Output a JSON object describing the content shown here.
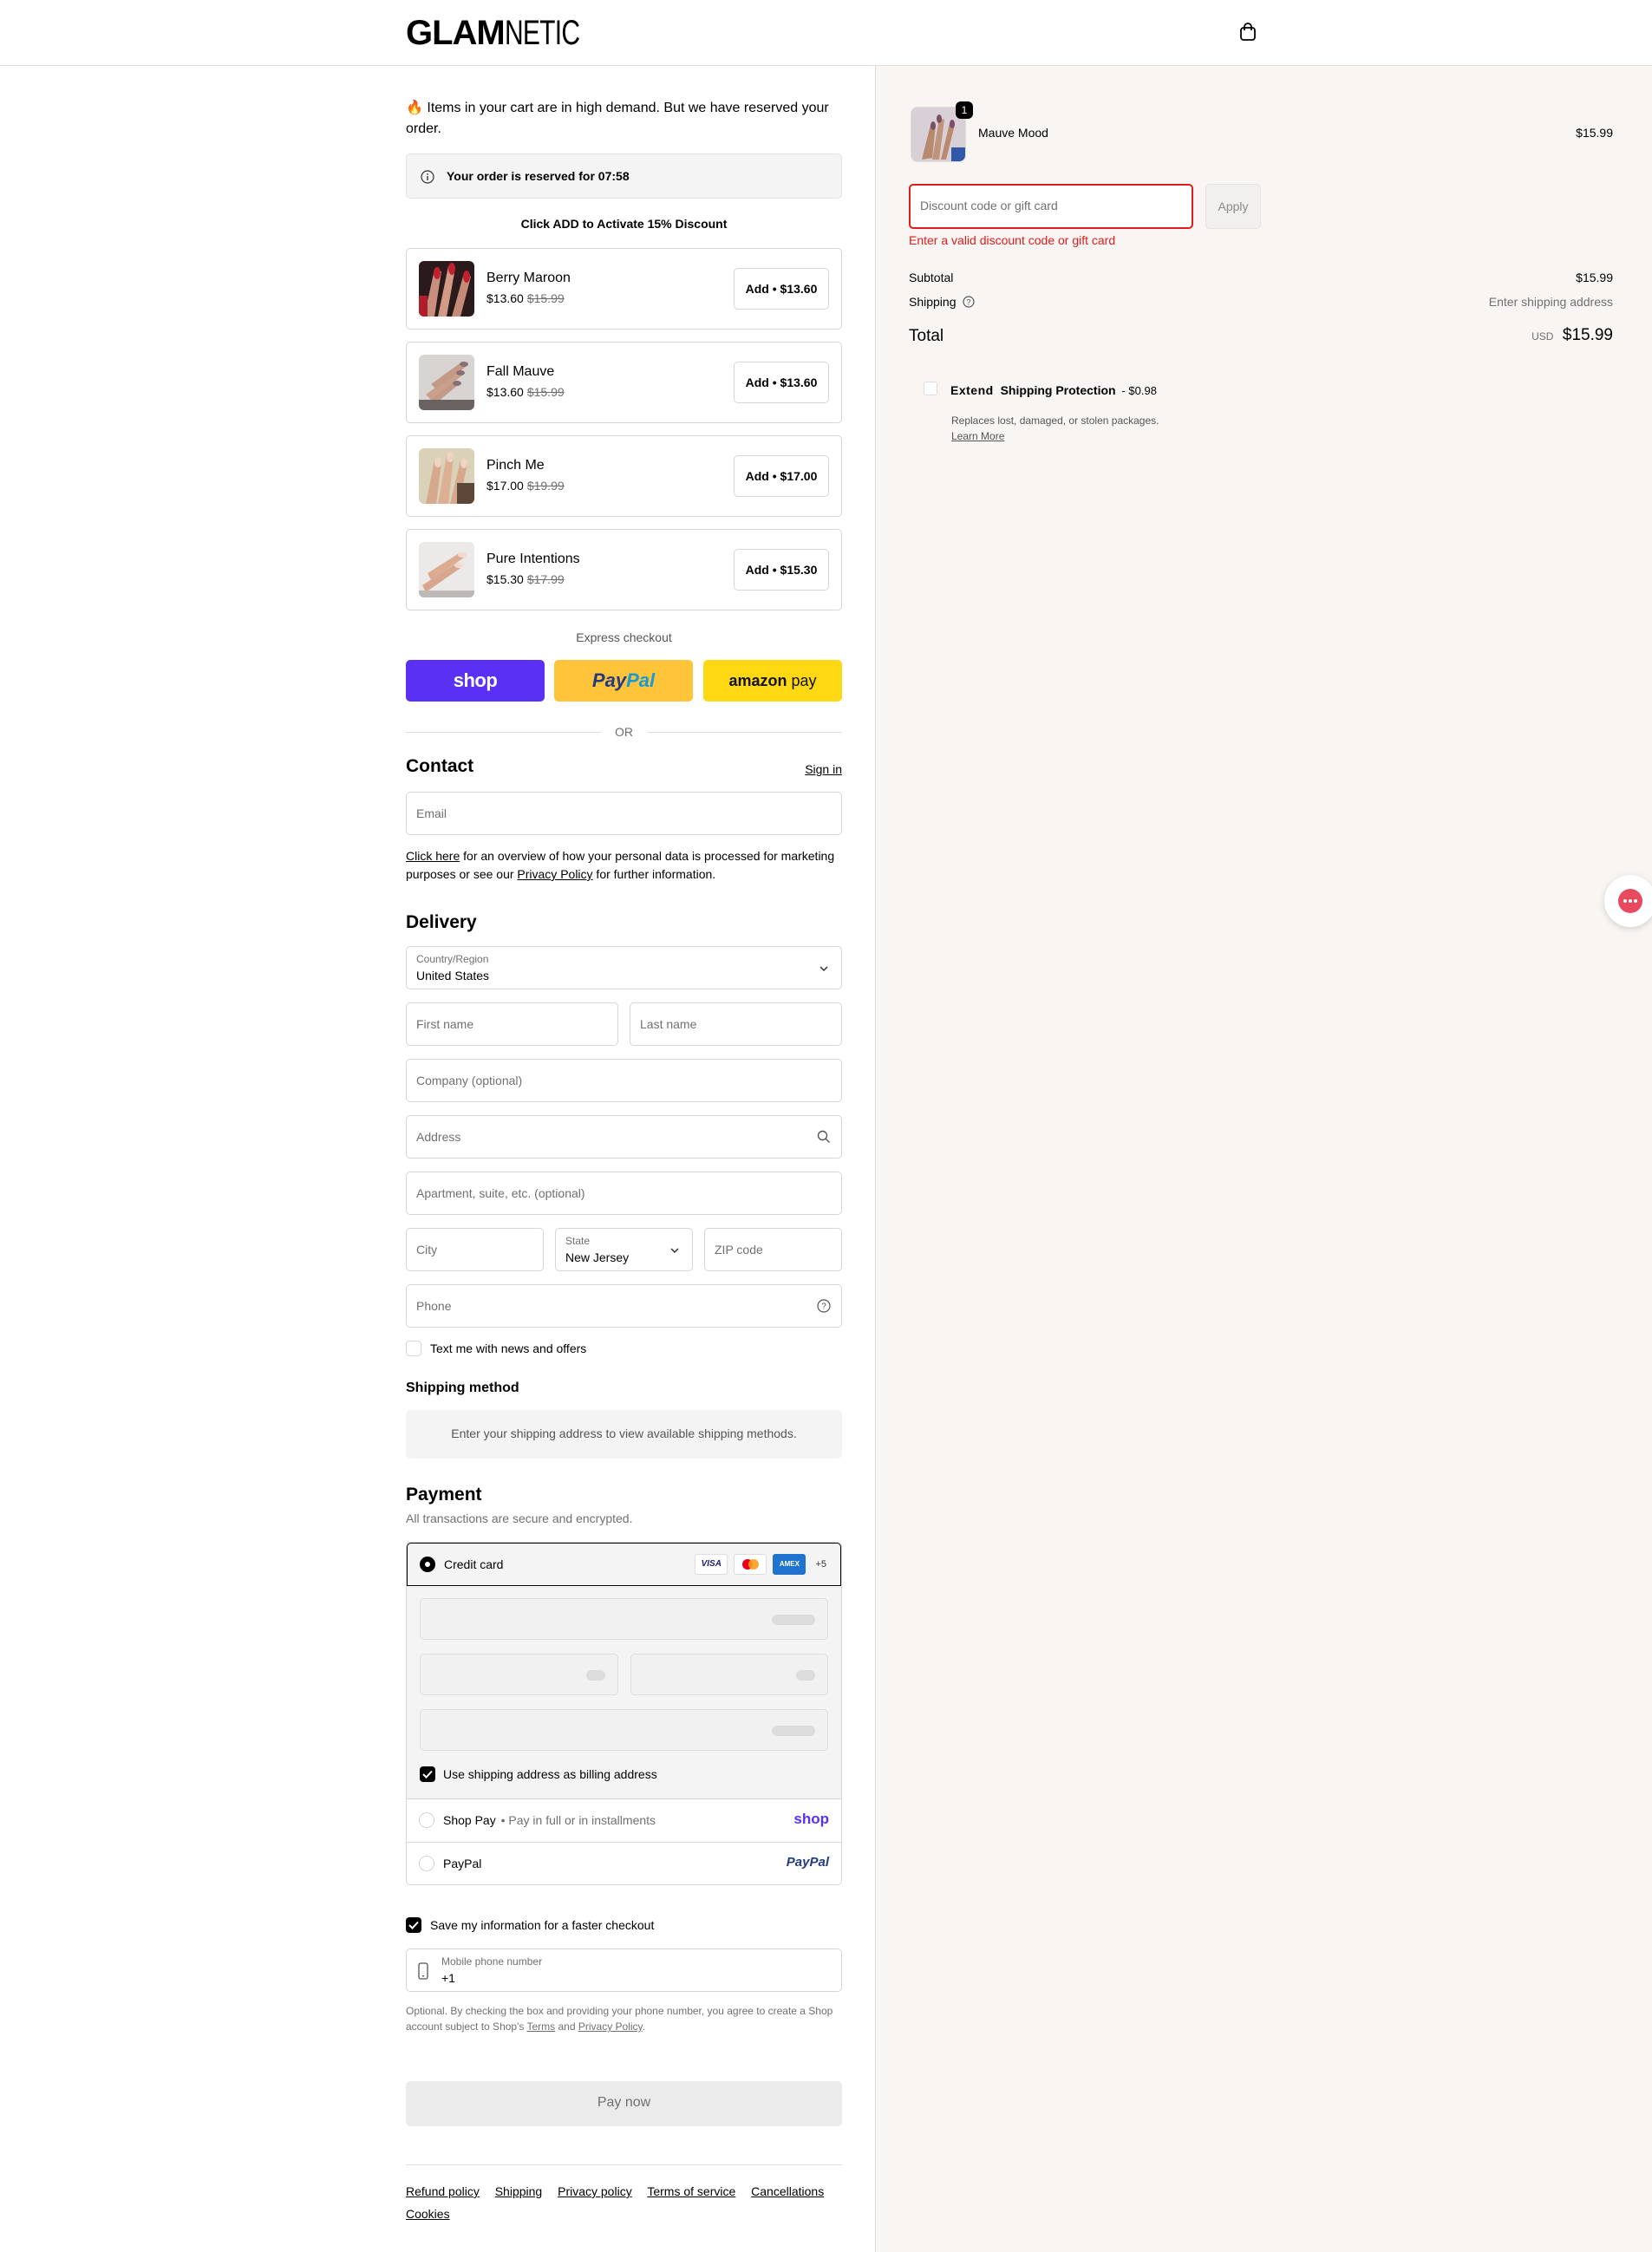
{
  "header": {
    "logo_bold": "GLAM",
    "logo_light": "NETIC"
  },
  "left": {
    "demand_notice": "🔥 Items in your cart are in high demand. But we have reserved your order.",
    "reserved_text": "Your order is reserved for 07:58",
    "upsell_heading": "Click ADD to Activate 15% Discount",
    "upsells": [
      {
        "name": "Berry Maroon",
        "price": "$13.60",
        "old_price": "$15.99",
        "button": "Add • $13.60"
      },
      {
        "name": "Fall Mauve",
        "price": "$13.60",
        "old_price": "$15.99",
        "button": "Add • $13.60"
      },
      {
        "name": "Pinch Me",
        "price": "$17.00",
        "old_price": "$19.99",
        "button": "Add • $17.00"
      },
      {
        "name": "Pure Intentions",
        "price": "$15.30",
        "old_price": "$17.99",
        "button": "Add • $15.30"
      }
    ],
    "express_label": "Express checkout",
    "express": {
      "shop": "shop",
      "paypal_pay": "Pay",
      "paypal_pal": "Pal",
      "amazon": "amazon",
      "amazon_pay": "pay"
    },
    "or": "OR",
    "contact": {
      "title": "Contact",
      "sign_in": "Sign in",
      "email_placeholder": "Email",
      "privacy_link": "Click here",
      "privacy_text_1": " for an overview of how your personal data is processed for marketing purposes or see our ",
      "privacy_policy": "Privacy Policy",
      "privacy_text_2": " for further information."
    },
    "delivery": {
      "title": "Delivery",
      "country_label": "Country/Region",
      "country_value": "United States",
      "first_name": "First name",
      "last_name": "Last name",
      "company": "Company (optional)",
      "address": "Address",
      "apartment": "Apartment, suite, etc. (optional)",
      "city": "City",
      "state_label": "State",
      "state_value": "New Jersey",
      "zip": "ZIP code",
      "phone": "Phone",
      "text_me": "Text me with news and offers"
    },
    "shipping_method": {
      "title": "Shipping method",
      "notice": "Enter your shipping address to view available shipping methods."
    },
    "payment": {
      "title": "Payment",
      "subtitle": "All transactions are secure and encrypted.",
      "credit_card": "Credit card",
      "visa": "VISA",
      "amex": "AMEX",
      "more_cards": "+5",
      "billing_same": "Use shipping address as billing address",
      "shop_pay": "Shop Pay",
      "shop_pay_sub": "• Pay in full or in installments",
      "shop_pay_logo": "shop",
      "paypal": "PayPal",
      "paypal_logo": "PayPal"
    },
    "save_info": "Save my information for a faster checkout",
    "mobile_label": "Mobile phone number",
    "mobile_value": "+1",
    "optional_text_1": "Optional. By checking the box and providing your phone number, you agree to create a Shop account subject to Shop's ",
    "terms": "Terms",
    "and": " and ",
    "privacy": "Privacy Policy",
    "period": ".",
    "pay_now": "Pay now",
    "footer_links": [
      "Refund policy",
      "Shipping",
      "Privacy policy",
      "Terms of service",
      "Cancellations",
      "Cookies"
    ]
  },
  "summary": {
    "item_name": "Mauve Mood",
    "item_qty": "1",
    "item_price": "$15.99",
    "discount_placeholder": "Discount code or gift card",
    "apply": "Apply",
    "discount_error": "Enter a valid discount code or gift card",
    "subtotal_label": "Subtotal",
    "subtotal_value": "$15.99",
    "shipping_label": "Shipping",
    "shipping_value": "Enter shipping address",
    "total_label": "Total",
    "total_currency": "USD",
    "total_value": "$15.99",
    "extend_brand": "Extend",
    "extend_title": "Shipping Protection",
    "extend_price": "- $0.98",
    "extend_desc": "Replaces lost, damaged, or stolen packages.",
    "learn_more": "Learn More"
  },
  "colors": {
    "shop_purple": "#5a31f4",
    "paypal_yellow": "#ffc439",
    "amazon_yellow": "#ffd814",
    "error_red": "#dd1d1d"
  }
}
